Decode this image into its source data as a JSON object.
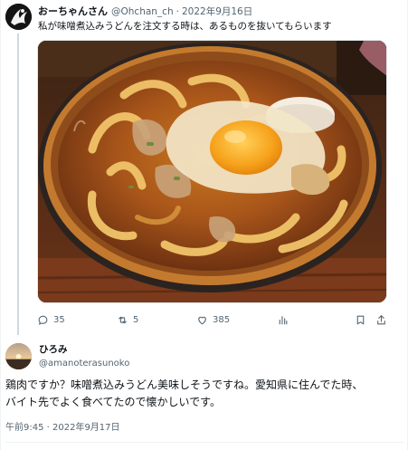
{
  "original_tweet": {
    "display_name": "おーちゃんさん",
    "handle": "@Ohchan_ch",
    "separator": "·",
    "date": "2022年9月16日",
    "text": "私が味噌煮込みうどんを注文する時は、あるものを抜いてもらいます",
    "photo_icon": "miso-nikomi-udon-photo",
    "actions": {
      "reply_count": "35",
      "retweet_count": "5",
      "like_count": "385"
    }
  },
  "reply_tweet": {
    "display_name": "ひろみ",
    "handle": "@amanoterasunoko",
    "text_lines": [
      "鶏肉ですか？味噌煮込みうどん美味しそうですね。愛知県に住んでた時、",
      "バイト先でよく食べてたので懐かしいです。"
    ],
    "timestamp": "午前9:45 · 2022年9月17日"
  },
  "colors": {
    "text_primary": "#0f1419",
    "text_secondary": "#536471",
    "thread_line": "#cfd9de",
    "border": "#eff3f4"
  }
}
